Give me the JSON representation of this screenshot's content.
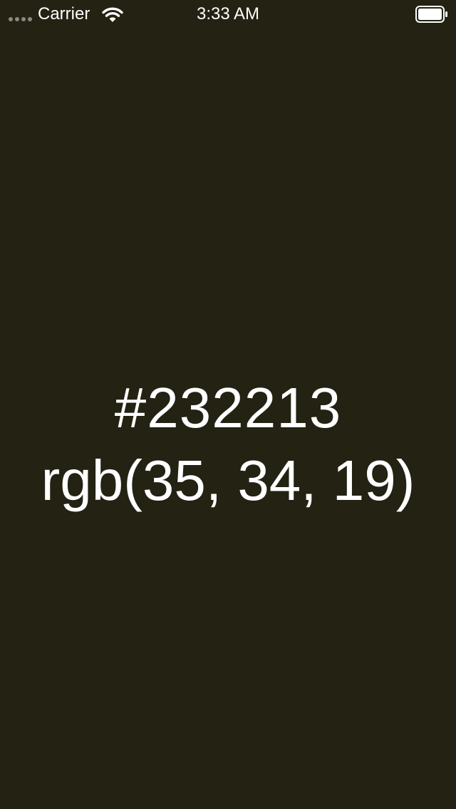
{
  "status_bar": {
    "carrier": "Carrier",
    "time": "3:33 AM"
  },
  "color": {
    "hex": "#232213",
    "rgb": "rgb(35, 34, 19)"
  },
  "colors": {
    "background": "#232213",
    "text": "#ffffff"
  },
  "icons": {
    "signal": "signal-dots-icon",
    "wifi": "wifi-icon",
    "battery": "battery-icon"
  }
}
